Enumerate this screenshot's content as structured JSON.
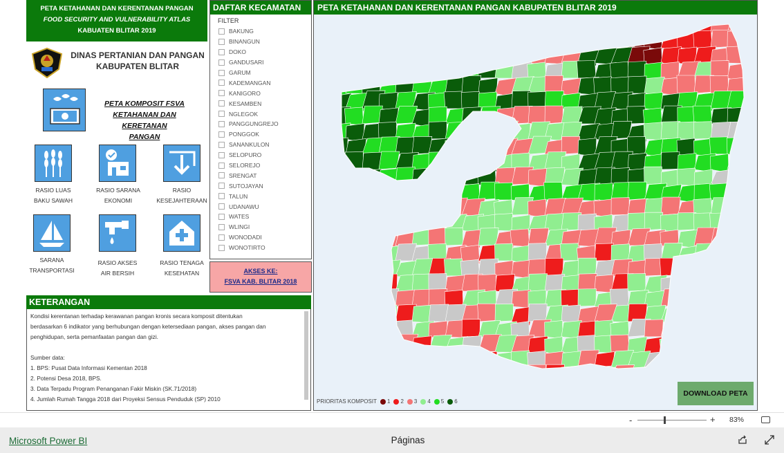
{
  "banner": {
    "line1": "PETA KETAHANAN DAN KERENTANAN PANGAN",
    "line2": "FOOD SECURITY AND VULNERABILITY ATLAS",
    "line3": "KABUATEN BLITAR 2019"
  },
  "agency": {
    "line1": "DINAS PERTANIAN DAN PANGAN",
    "line2": "KABUPATEN BLITAR"
  },
  "fsva_link": {
    "line1": "PETA KOMPOSIT FSVA",
    "line2": "KETAHANAN DAN KERETANAN",
    "line3": "PANGAN"
  },
  "indicators": [
    {
      "icon": "wheat-icon",
      "line1": "RASIO LUAS",
      "line2": "BAKU SAWAH"
    },
    {
      "icon": "store-icon",
      "line1": "RASIO SARANA",
      "line2": "EKONOMI"
    },
    {
      "icon": "download-icon",
      "line1": "RASIO",
      "line2": "KESEJAHTERAAN"
    },
    {
      "icon": "sailboat-icon",
      "line1": "SARANA",
      "line2": "TRANSPORTASI"
    },
    {
      "icon": "faucet-icon",
      "line1": "RASIO AKSES",
      "line2": "AIR BERSIH"
    },
    {
      "icon": "health-house-icon",
      "line1": "RASIO TENAGA",
      "line2": "KESEHATAN"
    }
  ],
  "daftar": {
    "title": "DAFTAR KECAMATAN",
    "filter": "FILTER",
    "items": [
      "BAKUNG",
      "BINANGUN",
      "DOKO",
      "GANDUSARI",
      "GARUM",
      "KADEMANGAN",
      "KANIGORO",
      "KESAMBEN",
      "NGLEGOK",
      "PANGGUNGREJO",
      "PONGGOK",
      "SANANKULON",
      "SELOPURO",
      "SELOREJO",
      "SRENGAT",
      "SUTOJAYAN",
      "TALUN",
      "UDANAWU",
      "WATES",
      "WLINGI",
      "WONODADI",
      "WONOTIRTO"
    ]
  },
  "akses": {
    "line1": "AKSES KE:",
    "line2": "FSVA KAB. BLITAR 2018"
  },
  "keterangan": {
    "title": "KETERANGAN",
    "lines": [
      "Kondisi kerentanan terhadap kerawanan pangan kronis secara komposit ditentukan",
      "berdasarkan 6 indikator yang berhubungan dengan ketersediaan pangan, akses pangan dan",
      "penghidupan, serta pemanfaatan pangan dan gizi.",
      "",
      "Sumber data:",
      "1. BPS: Pusat Data Informasi Kementan 2018",
      "2. Potensi Desa 2018, BPS.",
      "3. Data Terpadu Program Penanganan Fakir Miskin  (SK.71/2018)",
      "4. Jumlah Rumah Tangga 2018 dari Proyeksi Sensus Penduduk (SP) 2010"
    ]
  },
  "map": {
    "title": "PETA KETAHANAN DAN KERENTANAN PANGAN KABUPATEN BLITAR 2019",
    "download": "DOWNLOAD PETA",
    "legend_title": "PRIORITAS KOMPOSIT",
    "legend": [
      {
        "label": "1",
        "color": "#7a0a0a"
      },
      {
        "label": "2",
        "color": "#ee1c1c"
      },
      {
        "label": "3",
        "color": "#f47575"
      },
      {
        "label": "4",
        "color": "#90ee90"
      },
      {
        "label": "5",
        "color": "#22dd22"
      },
      {
        "label": "6",
        "color": "#0a5c0a"
      }
    ],
    "nodata_color": "#c9c9c9"
  },
  "zoom": {
    "minus": "-",
    "plus": "+",
    "percent": "83%",
    "level": 0.39
  },
  "footer": {
    "brand": "Microsoft Power BI",
    "pages": "Páginas"
  }
}
